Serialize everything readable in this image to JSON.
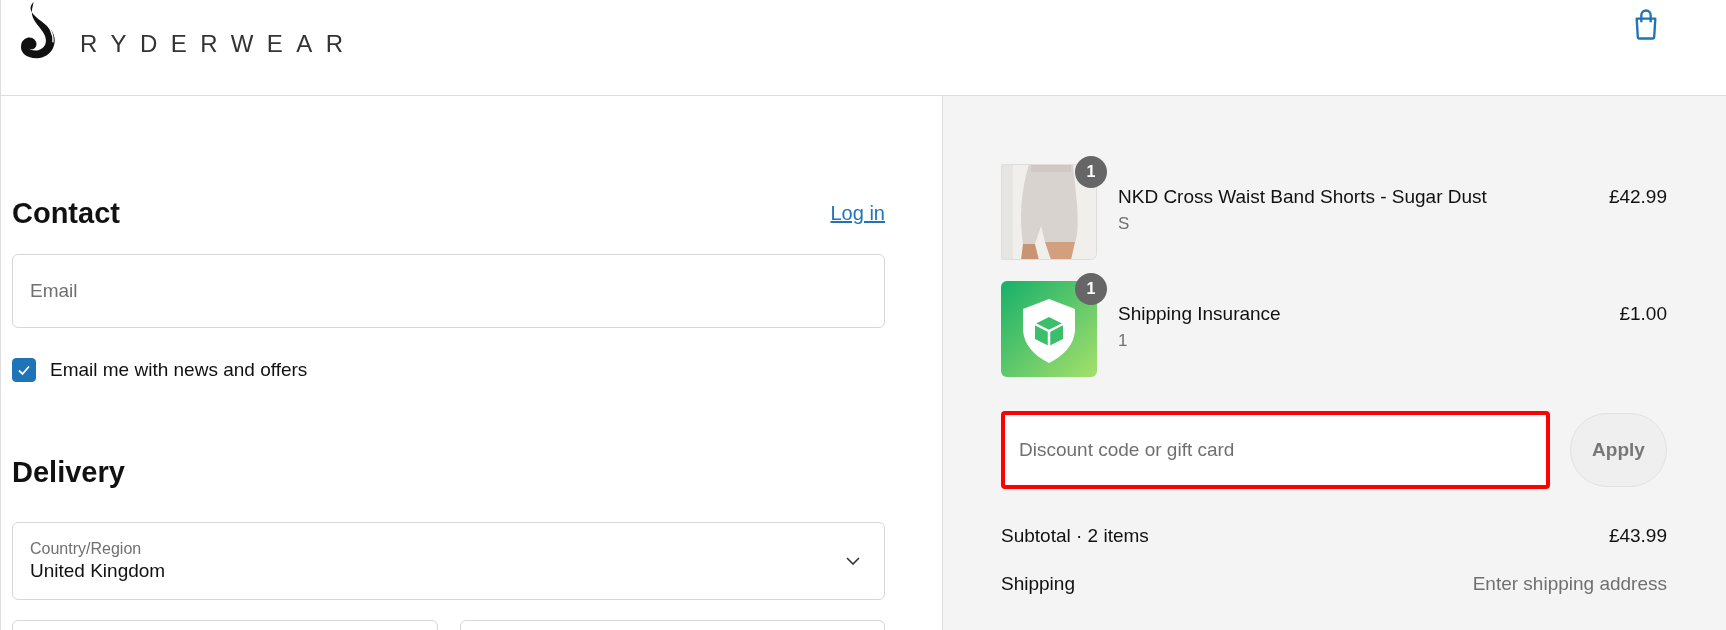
{
  "header": {
    "brand": "RYDERWEAR"
  },
  "contact": {
    "heading": "Contact",
    "login_link": "Log in",
    "email": {
      "placeholder": "Email"
    },
    "newsletter": {
      "label": "Email me with news and offers",
      "checked": true
    }
  },
  "delivery": {
    "heading": "Delivery",
    "country": {
      "label": "Country/Region",
      "value": "United Kingdom"
    },
    "partial_fields": [
      {
        "kind": "text"
      },
      {
        "kind": "text"
      }
    ]
  },
  "order": {
    "items": [
      {
        "quantity": "1",
        "name": "NKD Cross Waist Band Shorts - Sugar Dust",
        "variant": "S",
        "price": "£42.99"
      },
      {
        "kind": "shield",
        "quantity": "1",
        "name": "Shipping Insurance",
        "variant": "1",
        "price": "£1.00"
      }
    ],
    "discount": {
      "placeholder": "Discount code or gift card",
      "highlighted": true,
      "button": "Apply",
      "disabled": true
    },
    "summary": [
      {
        "label": "Subtotal · 2 items",
        "value": "£43.99",
        "muted": false
      },
      {
        "label": "Shipping",
        "value": "Enter shipping address",
        "muted": true
      }
    ]
  }
}
